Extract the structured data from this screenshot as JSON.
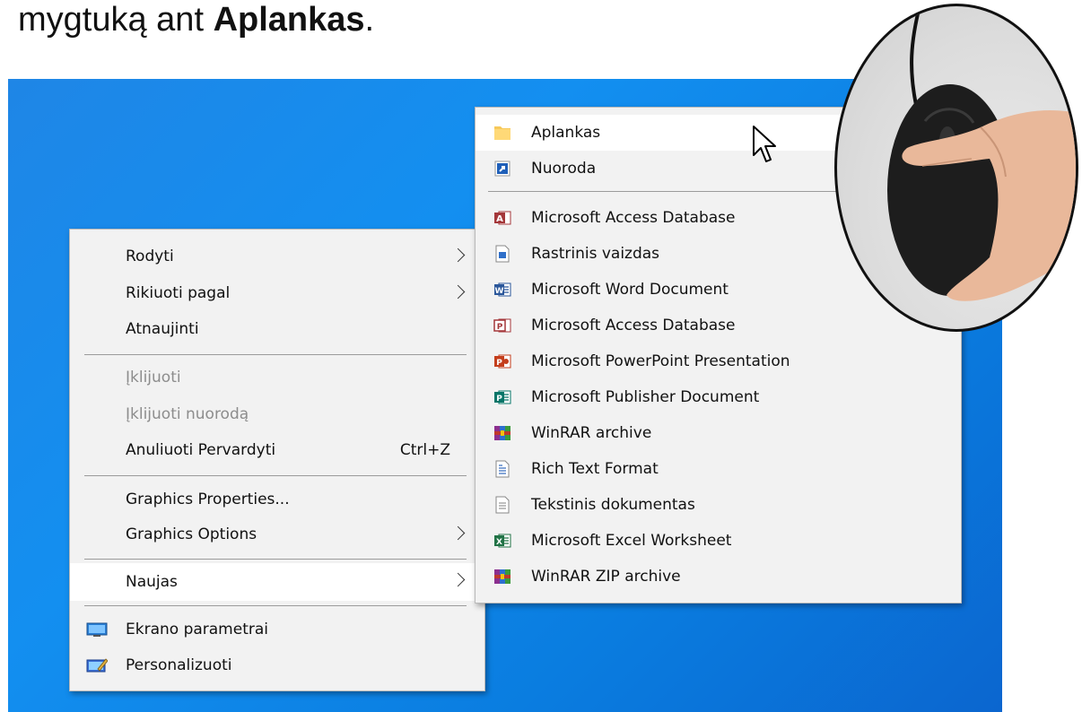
{
  "caption": {
    "prefix": "mygtuką ant ",
    "bold": "Aplankas",
    "suffix": "."
  },
  "main_menu": {
    "items": [
      {
        "label": "Rodyti"
      },
      {
        "label": "Rikiuoti pagal"
      },
      {
        "label": "Atnaujinti"
      },
      {
        "label": "Įklijuoti"
      },
      {
        "label": "Įklijuoti nuorodą"
      },
      {
        "label": "Anuliuoti Pervardyti",
        "shortcut": "Ctrl+Z"
      },
      {
        "label": "Graphics Properties..."
      },
      {
        "label": "Graphics Options"
      },
      {
        "label": "Naujas"
      },
      {
        "label": "Ekrano parametrai"
      },
      {
        "label": "Personalizuoti"
      }
    ]
  },
  "sub_menu": {
    "items": [
      {
        "label": "Aplankas",
        "icon": "folder-icon"
      },
      {
        "label": "Nuoroda",
        "icon": "shortcut-icon"
      },
      {
        "label": "Microsoft Access Database",
        "icon": "access-icon"
      },
      {
        "label": "Rastrinis vaizdas",
        "icon": "bitmap-icon"
      },
      {
        "label": "Microsoft Word Document",
        "icon": "word-icon"
      },
      {
        "label": "Microsoft Access Database",
        "icon": "access-icon"
      },
      {
        "label": "Microsoft PowerPoint Presentation",
        "icon": "powerpoint-icon"
      },
      {
        "label": "Microsoft Publisher Document",
        "icon": "publisher-icon"
      },
      {
        "label": "WinRAR archive",
        "icon": "winrar-icon"
      },
      {
        "label": "Rich Text Format",
        "icon": "rtf-icon"
      },
      {
        "label": "Tekstinis dokumentas",
        "icon": "text-document-icon"
      },
      {
        "label": "Microsoft Excel Worksheet",
        "icon": "excel-icon"
      },
      {
        "label": "WinRAR ZIP archive",
        "icon": "winrar-zip-icon"
      }
    ]
  },
  "colors": {
    "desktop": "#138ff0",
    "menu_bg": "#f2f2f2",
    "highlight": "#ffffff",
    "disabled_text": "#8d8d8d"
  }
}
